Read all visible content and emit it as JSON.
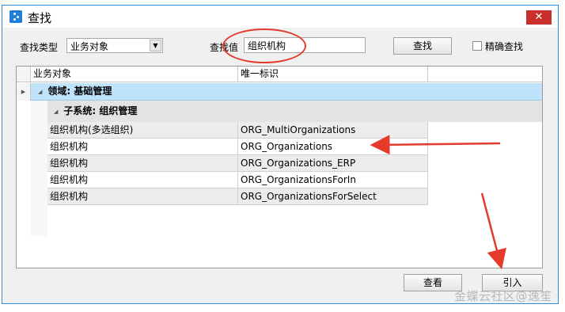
{
  "window": {
    "title": "查找",
    "close_label": "✕"
  },
  "search": {
    "type_label": "查找类型",
    "type_value": "业务对象",
    "value_label": "查找值",
    "value": "组织机构",
    "find_button": "查找",
    "exact_label": "精确查找"
  },
  "grid": {
    "columns": [
      "业务对象",
      "唯一标识"
    ],
    "group1": "领域: 基础管理",
    "group2": "子系统: 组织管理",
    "rows": [
      {
        "name": "组织机构(多选组织)",
        "id": "ORG_MultiOrganizations"
      },
      {
        "name": "组织机构",
        "id": "ORG_Organizations"
      },
      {
        "name": "组织机构",
        "id": "ORG_Organizations_ERP"
      },
      {
        "name": "组织机构",
        "id": "ORG_OrganizationsForIn"
      },
      {
        "name": "组织机构",
        "id": "ORG_OrganizationsForSelect"
      }
    ]
  },
  "footer": {
    "view_button": "查看",
    "import_button": "引入"
  },
  "watermark": "金蝶云社区@逸笙",
  "colors": {
    "accent": "#2e8bd6",
    "annotation": "#e53b2c",
    "group_highlight": "#bfe3fb"
  }
}
